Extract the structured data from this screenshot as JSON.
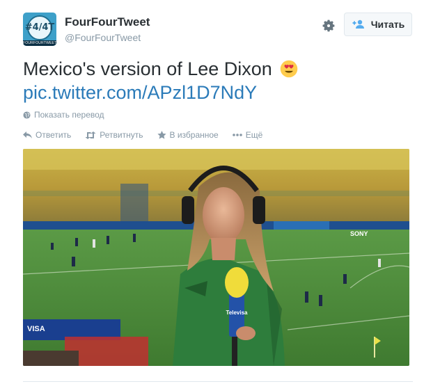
{
  "header": {
    "avatar_text": "#4/4T",
    "avatar_footer": "FOURFOURTWEET",
    "fullname": "FourFourTweet",
    "username": "@FourFourTweet",
    "follow_label": "Читать"
  },
  "tweet": {
    "text": "Mexico's version of Lee Dixon",
    "link": "pic.twitter.com/APzl1D7NdY"
  },
  "translate_label": "Показать перевод",
  "actions": {
    "reply": "Ответить",
    "retweet": "Ретвитнуть",
    "favorite": "В избранное",
    "more": "Ещё"
  },
  "photo": {
    "board_brand": "SONY",
    "board_left": "VISA",
    "mic_brand": "Televisa"
  },
  "colors": {
    "link": "#2b7bb9",
    "muted": "#8899a6",
    "text": "#292f33",
    "pitch": "#4f8a3a",
    "jersey": "#2e7d3c"
  }
}
